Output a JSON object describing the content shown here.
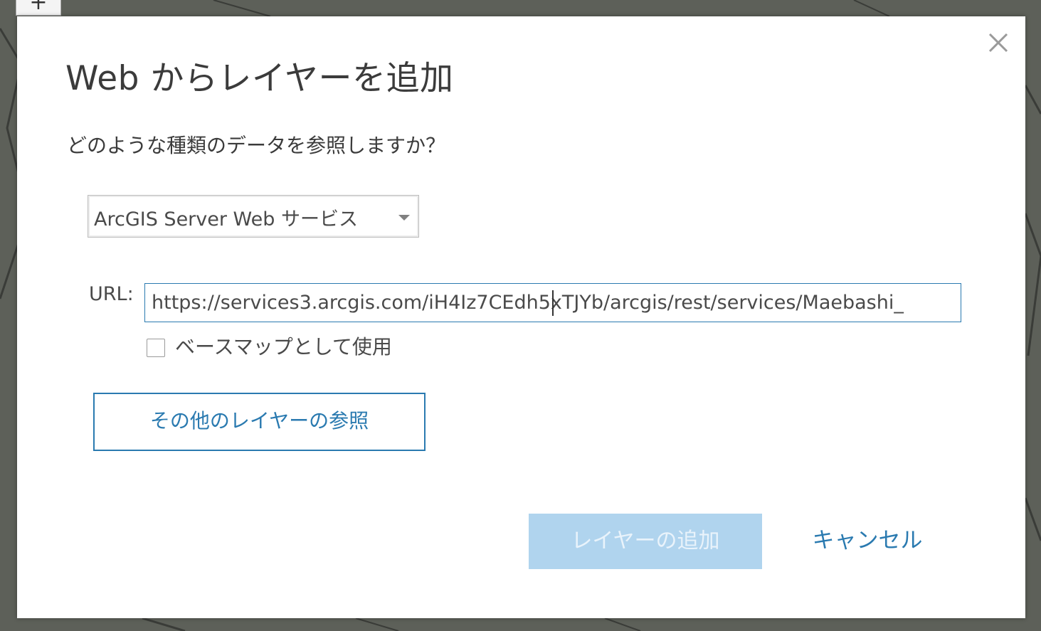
{
  "map": {
    "zoom_in_label": "+"
  },
  "dialog": {
    "title": "Web からレイヤーを追加",
    "close_icon": "close-icon",
    "question": "どのような種類のデータを参照しますか？",
    "data_type_select": {
      "selected": "ArcGIS Server Web サービス"
    },
    "url": {
      "label": "URL:",
      "value": "https://services3.arcgis.com/iH4Iz7CEdh5xTJYb/arcgis/rest/services/Maebashi_"
    },
    "basemap_checkbox": {
      "label": "ベースマップとして使用",
      "checked": false
    },
    "browse_button_label": "その他のレイヤーの参照",
    "add_button_label": "レイヤーの追加",
    "add_button_enabled": false,
    "cancel_button_label": "キャンセル"
  },
  "colors": {
    "accent": "#2a7ab0",
    "disabled_button": "#b0d4ee",
    "text": "#4a4a4a"
  }
}
